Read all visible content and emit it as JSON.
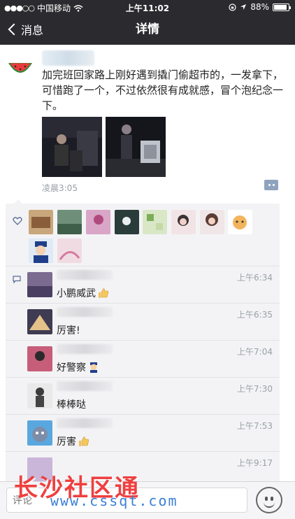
{
  "status_bar": {
    "carrier": "中国移动",
    "time": "上午11:02",
    "battery": "88%",
    "battery_level": 0.88
  },
  "nav": {
    "back_label": "消息",
    "title": "详情"
  },
  "post": {
    "text": "加完班回家路上刚好遇到撬门偷超市的，一发拿下，可惜跑了一个，不过依然很有成就感，冒个泡纪念一下。",
    "time": "凌晨3:05"
  },
  "comments": [
    {
      "text": "小鹏威武",
      "time": "上午6:34",
      "emoji": "thumbs-up"
    },
    {
      "text": "厉害!",
      "time": "上午6:35",
      "emoji": ""
    },
    {
      "text": "好警察",
      "time": "上午7:04",
      "emoji": "police-officer"
    },
    {
      "text": "棒棒哒",
      "time": "上午7:30",
      "emoji": ""
    },
    {
      "text": "厉害",
      "time": "上午7:53",
      "emoji": "thumbs-up"
    },
    {
      "text": "",
      "time": "上午9:17",
      "emoji": ""
    }
  ],
  "watermark": {
    "brand": "长沙社区通",
    "url": "www.cssqt.com"
  },
  "input": {
    "placeholder": "评论"
  },
  "colors": {
    "nav_bg": "#2b2b2f",
    "likes_bg": "#f3f3f5",
    "link_blue": "#576b95"
  }
}
